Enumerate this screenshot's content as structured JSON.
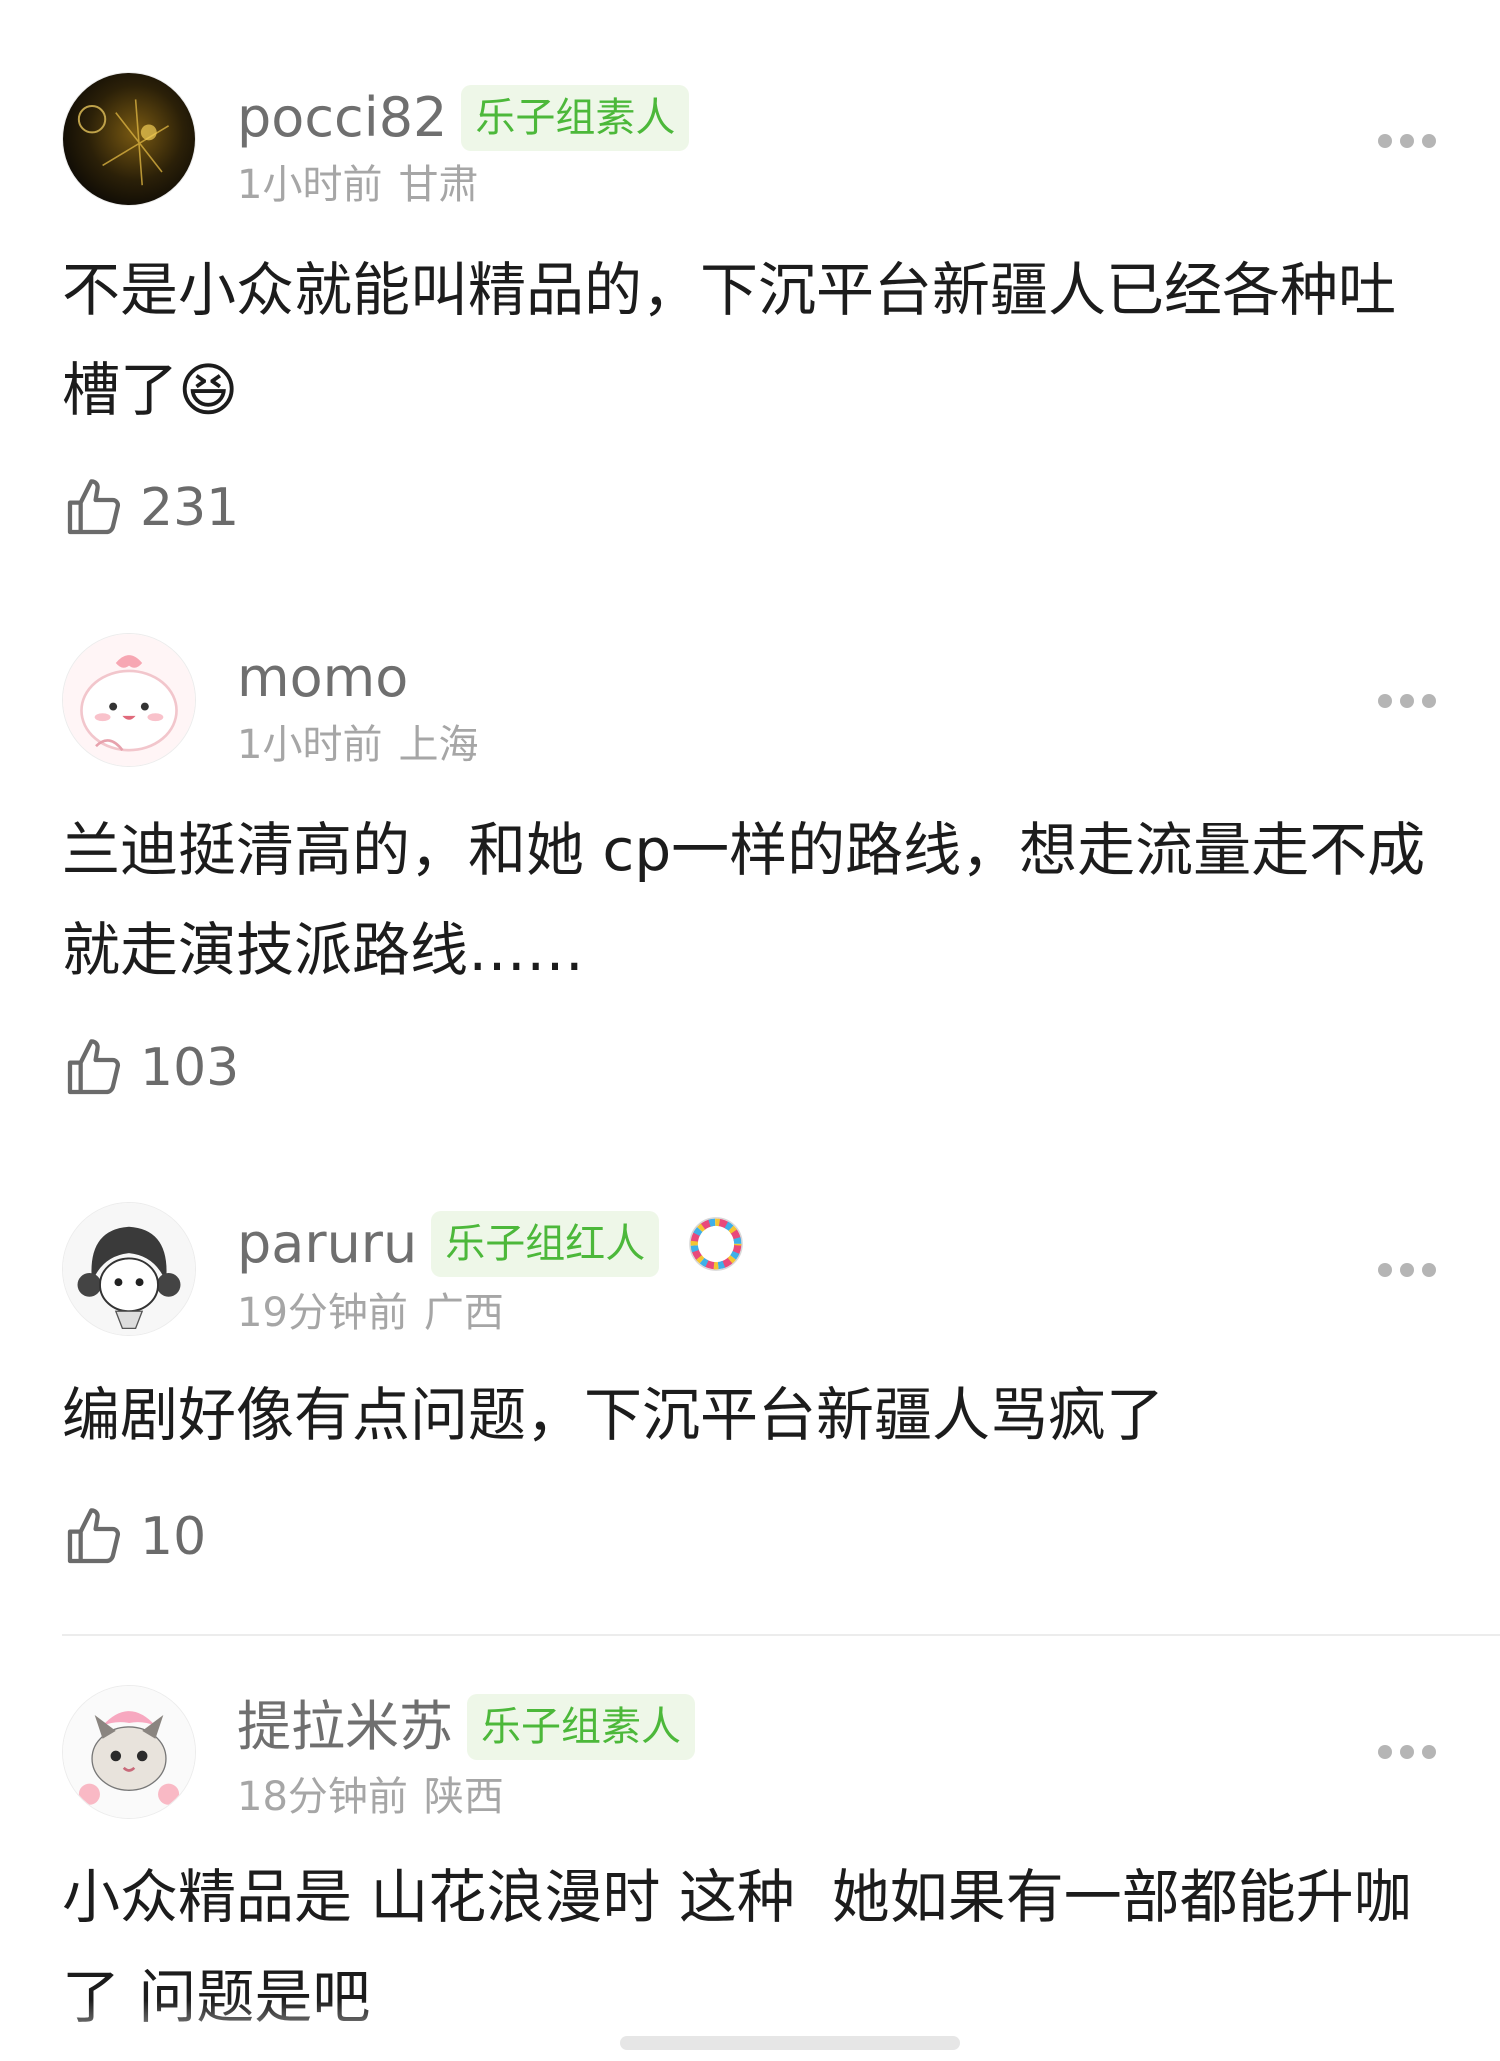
{
  "comments": [
    {
      "username": "pocci82",
      "badge": "乐子组素人",
      "time": "1小时前",
      "location": "甘肃",
      "text": "不是小众就能叫精品的，下沉平台新疆人已经各种吐槽了",
      "emoji": "😆",
      "likes": "231"
    },
    {
      "username": "momo",
      "time": "1小时前",
      "location": "上海",
      "text": "兰迪挺清高的，和她 cp一样的路线，想走流量走不成就走演技派路线……",
      "likes": "103"
    },
    {
      "username": "paruru",
      "badge": "乐子组红人",
      "time": "19分钟前",
      "location": "广西",
      "text": "编剧好像有点问题，下沉平台新疆人骂疯了",
      "likes": "10"
    },
    {
      "username": "提拉米苏",
      "badge": "乐子组素人",
      "time": "18分钟前",
      "location": "陕西",
      "text": "小众精品是 山花浪漫时 这种  她如果有一部都能升咖了 问题是吧"
    }
  ],
  "icons": {
    "like": "thumbs-up-icon",
    "more": "more-dots-icon"
  },
  "colors": {
    "badge_text": "#4cb83a",
    "badge_bg": "#eef7e8",
    "meta": "#a6a6a6",
    "username": "#6f6f6f"
  }
}
